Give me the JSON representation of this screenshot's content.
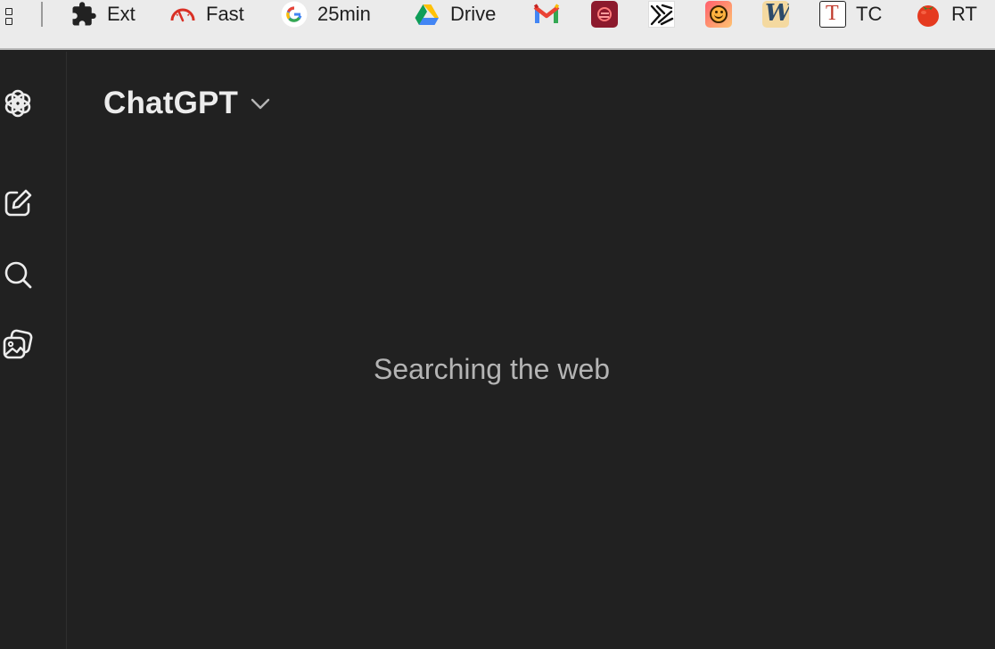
{
  "bookmarks": [
    {
      "id": "ext",
      "icon": "puzzle-icon",
      "label": "Ext"
    },
    {
      "id": "fast",
      "icon": "speedometer-icon",
      "label": "Fast"
    },
    {
      "id": "25min",
      "icon": "google-icon",
      "label": "25min"
    },
    {
      "id": "drive",
      "icon": "google-drive-icon",
      "label": "Drive"
    },
    {
      "id": "gmail",
      "icon": "gmail-icon",
      "label": ""
    },
    {
      "id": "b6",
      "icon": "red-app-icon",
      "label": ""
    },
    {
      "id": "b7",
      "icon": "scribble-icon",
      "label": ""
    },
    {
      "id": "b8",
      "icon": "smiley-icon",
      "label": ""
    },
    {
      "id": "b9",
      "icon": "w-letter-icon",
      "label": ""
    },
    {
      "id": "tc",
      "icon": "t-letter-icon",
      "label": "TC"
    },
    {
      "id": "rt",
      "icon": "tomato-icon",
      "label": "RT"
    }
  ],
  "bookmark_letters": {
    "w": "W",
    "t": "T"
  },
  "sidebar": {
    "items": [
      {
        "name": "chatgpt-logo-icon"
      },
      {
        "name": "new-chat-icon"
      },
      {
        "name": "search-icon"
      },
      {
        "name": "library-icon"
      }
    ]
  },
  "header": {
    "model_name": "ChatGPT"
  },
  "main": {
    "status": "Searching the web"
  },
  "colors": {
    "background": "#212121",
    "bookmarks_bar": "#ebebeb",
    "text_primary": "#ececec",
    "text_secondary": "#b4b4b4",
    "speedometer": "#d93025",
    "tomato": "#e53a1f"
  }
}
